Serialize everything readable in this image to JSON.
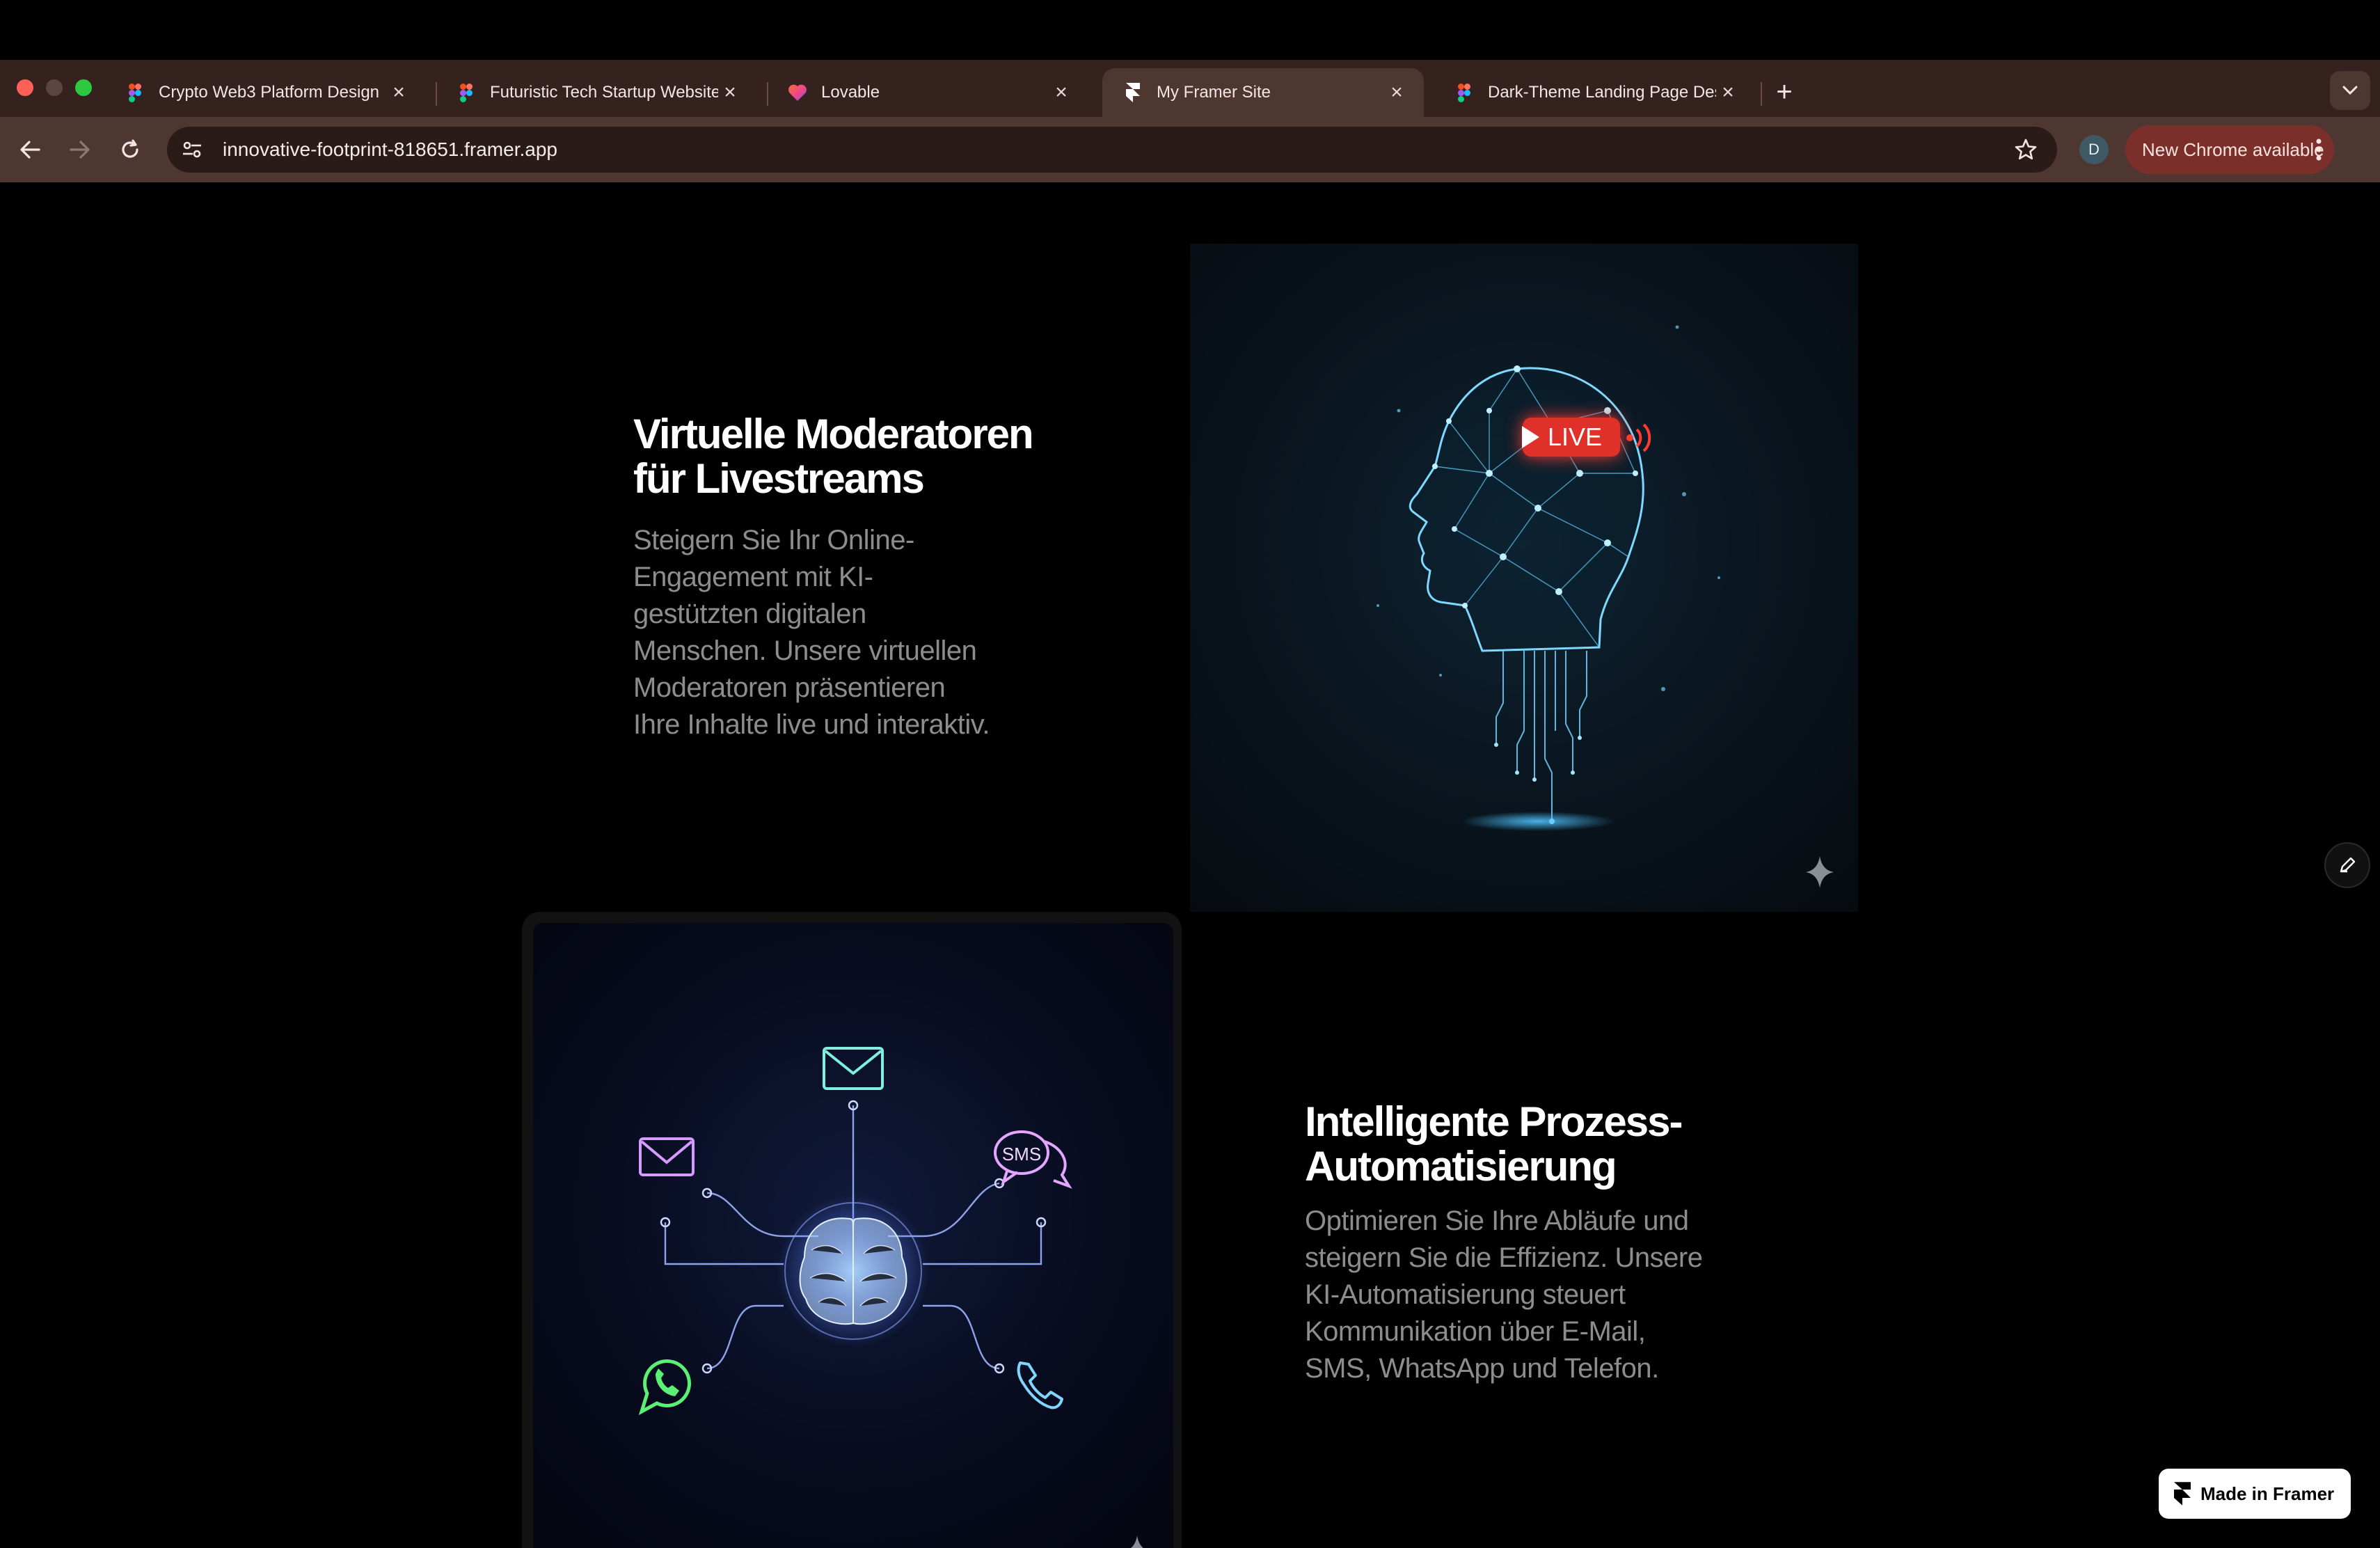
{
  "browser": {
    "tabs": [
      {
        "title": "Crypto Web3 Platform Design",
        "favicon": "figma-icon",
        "active": false
      },
      {
        "title": "Futuristic Tech Startup Website",
        "favicon": "figma-icon",
        "active": false
      },
      {
        "title": "Lovable",
        "favicon": "lovable-heart-icon",
        "active": false
      },
      {
        "title": "My Framer Site",
        "favicon": "framer-icon",
        "active": true
      },
      {
        "title": "Dark-Theme Landing Page Design",
        "favicon": "figma-icon",
        "active": false
      }
    ],
    "url": "innovative-footprint-818651.framer.app",
    "profile_initial": "D",
    "update_label": "New Chrome available"
  },
  "sections": [
    {
      "title_line1": "Virtuelle Moderatoren",
      "title_line2": "für Livestreams",
      "body_lines": [
        "Steigern Sie Ihr Online-",
        "Engagement mit KI-",
        "gestützten digitalen",
        "Menschen. Unsere virtuellen",
        "Moderatoren präsentieren",
        "Ihre Inhalte live und interaktiv."
      ],
      "image_badge": "LIVE"
    },
    {
      "title_line1": "Intelligente Prozess-",
      "title_line2": "Automatisierung",
      "body_lines": [
        "Optimieren Sie Ihre Abläufe und",
        "steigern Sie die Effizienz. Unsere",
        "KI-Automatisierung steuert",
        "Kommunikation über E-Mail,",
        "SMS, WhatsApp und Telefon."
      ],
      "image_badge": "SMS"
    }
  ],
  "badge": {
    "label": "Made in Framer"
  },
  "colors": {
    "chrome_bg": "#35221f",
    "toolbar_bg": "#4e3631",
    "update_btn": "#7a2f2a",
    "live_red": "#e0302a",
    "page_bg": "#000000"
  }
}
